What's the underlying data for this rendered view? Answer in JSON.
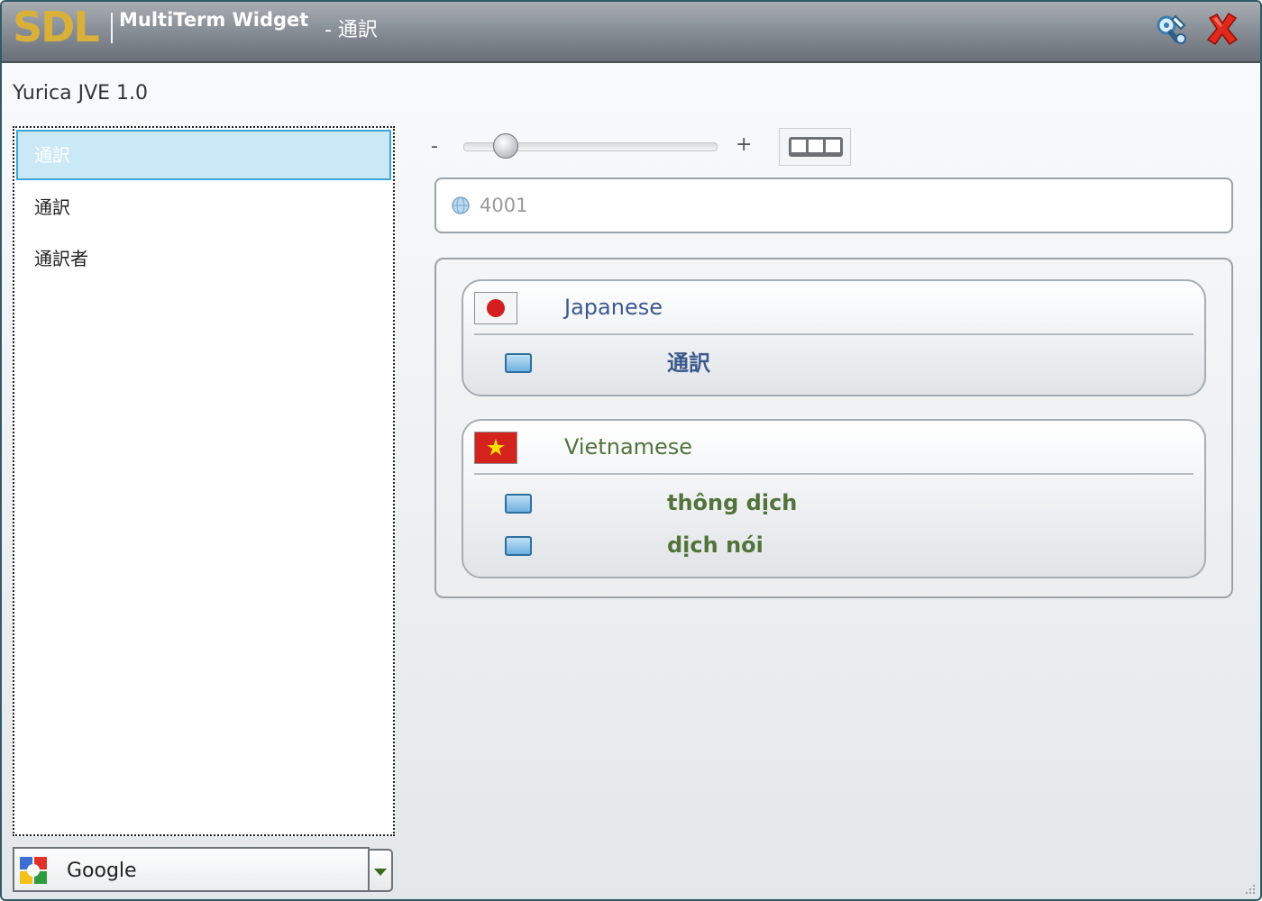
{
  "titlebar": {
    "logo_text": "SDL",
    "product_name": "MultiTerm Widget",
    "title_term": "- 通訳",
    "settings_icon": "tools-icon",
    "close_icon": "close-icon"
  },
  "app_label": "Yurica JVE 1.0",
  "term_list": {
    "items": [
      {
        "label": "通訳",
        "selected": true
      },
      {
        "label": "通訳",
        "selected": false
      },
      {
        "label": "通訳者",
        "selected": false
      }
    ]
  },
  "provider_combo": {
    "selected": "Google",
    "icon": "google-icon"
  },
  "toolbar": {
    "zoom_minus": "-",
    "zoom_plus": "+",
    "zoom_level": 0.13,
    "layout_icon": "three-column-layout-icon"
  },
  "search": {
    "value": "4001",
    "icon": "globe-icon"
  },
  "results": {
    "languages": [
      {
        "name": "Japanese",
        "flag": "japan-flag-icon",
        "color": "#3c5a8c",
        "terms": [
          "通訳"
        ]
      },
      {
        "name": "Vietnamese",
        "flag": "vietnam-flag-icon",
        "color": "#52733a",
        "terms": [
          "thông dịch",
          "dịch nói"
        ]
      }
    ]
  }
}
